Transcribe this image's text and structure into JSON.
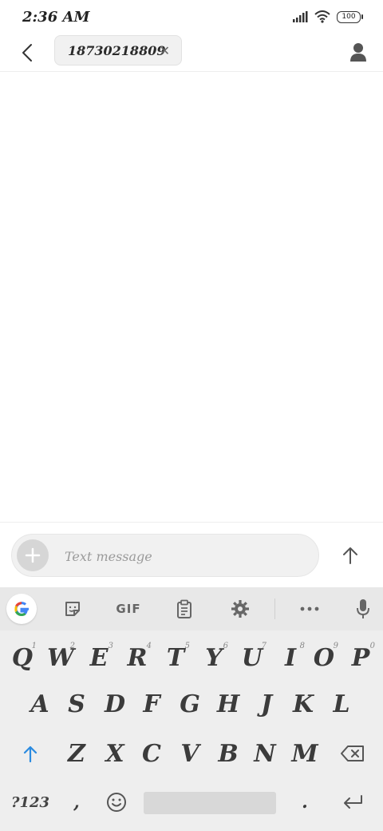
{
  "status_bar": {
    "time": "2:36 AM",
    "battery": "100"
  },
  "header": {
    "recipient": "18730218809"
  },
  "compose": {
    "placeholder": "Text message"
  },
  "keyboard": {
    "toolbar": {
      "gif_label": "GIF"
    },
    "row1": [
      {
        "key": "Q",
        "hint": "1"
      },
      {
        "key": "W",
        "hint": "2"
      },
      {
        "key": "E",
        "hint": "3"
      },
      {
        "key": "R",
        "hint": "4"
      },
      {
        "key": "T",
        "hint": "5"
      },
      {
        "key": "Y",
        "hint": "6"
      },
      {
        "key": "U",
        "hint": "7"
      },
      {
        "key": "I",
        "hint": "8"
      },
      {
        "key": "O",
        "hint": "9"
      },
      {
        "key": "P",
        "hint": "0"
      }
    ],
    "row2": [
      "A",
      "S",
      "D",
      "F",
      "G",
      "H",
      "J",
      "K",
      "L"
    ],
    "row3": [
      "Z",
      "X",
      "C",
      "V",
      "B",
      "N",
      "M"
    ],
    "bottom": {
      "symbols": "?123",
      "comma": ",",
      "period": "."
    }
  }
}
